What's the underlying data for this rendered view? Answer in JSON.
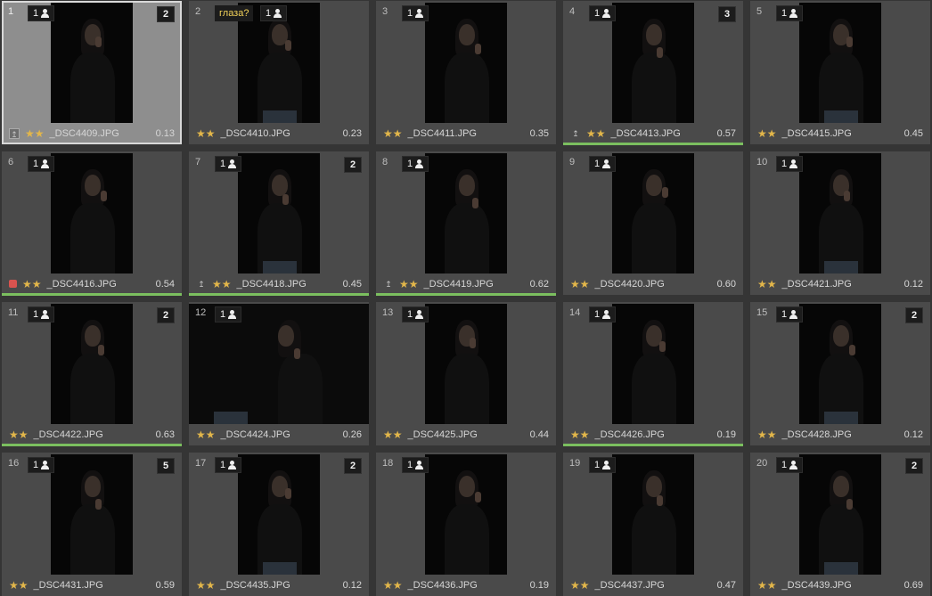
{
  "cells": [
    {
      "num": "1",
      "faces": "1",
      "stack": "2",
      "file": "_DSC4409.JPG",
      "score": "0.13",
      "stars": "★★",
      "flag": "up",
      "selected": true
    },
    {
      "num": "2",
      "faces": "1",
      "note": "глаза?",
      "file": "_DSC4410.JPG",
      "score": "0.23",
      "stars": "★★"
    },
    {
      "num": "3",
      "faces": "1",
      "file": "_DSC4411.JPG",
      "score": "0.35",
      "stars": "★★"
    },
    {
      "num": "4",
      "faces": "1",
      "stack": "3",
      "file": "_DSC4413.JPG",
      "score": "0.57",
      "stars": "★★",
      "flag": "up",
      "green": true
    },
    {
      "num": "5",
      "faces": "1",
      "file": "_DSC4415.JPG",
      "score": "0.45",
      "stars": "★★"
    },
    {
      "num": "6",
      "faces": "1",
      "file": "_DSC4416.JPG",
      "score": "0.54",
      "stars": "★★",
      "flag": "red",
      "green": true
    },
    {
      "num": "7",
      "faces": "1",
      "stack": "2",
      "file": "_DSC4418.JPG",
      "score": "0.45",
      "stars": "★★",
      "flag": "up",
      "green": true
    },
    {
      "num": "8",
      "faces": "1",
      "file": "_DSC4419.JPG",
      "score": "0.62",
      "stars": "★★",
      "flag": "up",
      "green": true
    },
    {
      "num": "9",
      "faces": "1",
      "file": "_DSC4420.JPG",
      "score": "0.60",
      "stars": "★★"
    },
    {
      "num": "10",
      "faces": "1",
      "file": "_DSC4421.JPG",
      "score": "0.12",
      "stars": "★★"
    },
    {
      "num": "11",
      "faces": "1",
      "stack": "2",
      "file": "_DSC4422.JPG",
      "score": "0.63",
      "stars": "★★",
      "green": true
    },
    {
      "num": "12",
      "faces": "1",
      "file": "_DSC4424.JPG",
      "score": "0.26",
      "stars": "★★",
      "wide": true
    },
    {
      "num": "13",
      "faces": "1",
      "file": "_DSC4425.JPG",
      "score": "0.44",
      "stars": "★★"
    },
    {
      "num": "14",
      "faces": "1",
      "file": "_DSC4426.JPG",
      "score": "0.19",
      "stars": "★★",
      "green": true
    },
    {
      "num": "15",
      "faces": "1",
      "stack": "2",
      "file": "_DSC4428.JPG",
      "score": "0.12",
      "stars": "★★"
    },
    {
      "num": "16",
      "faces": "1",
      "stack": "5",
      "file": "_DSC4431.JPG",
      "score": "0.59",
      "stars": "★★"
    },
    {
      "num": "17",
      "faces": "1",
      "stack": "2",
      "file": "_DSC4435.JPG",
      "score": "0.12",
      "stars": "★★"
    },
    {
      "num": "18",
      "faces": "1",
      "file": "_DSC4436.JPG",
      "score": "0.19",
      "stars": "★★"
    },
    {
      "num": "19",
      "faces": "1",
      "file": "_DSC4437.JPG",
      "score": "0.47",
      "stars": "★★"
    },
    {
      "num": "20",
      "faces": "1",
      "stack": "2",
      "file": "_DSC4439.JPG",
      "score": "0.69",
      "stars": "★★"
    }
  ],
  "icons": {
    "person": "person-icon",
    "upload": "↥"
  },
  "colors": {
    "accent_green": "#7bbf5f",
    "star": "#e2b64a",
    "note_text": "#f4d35a",
    "red_label": "#d9534f"
  }
}
